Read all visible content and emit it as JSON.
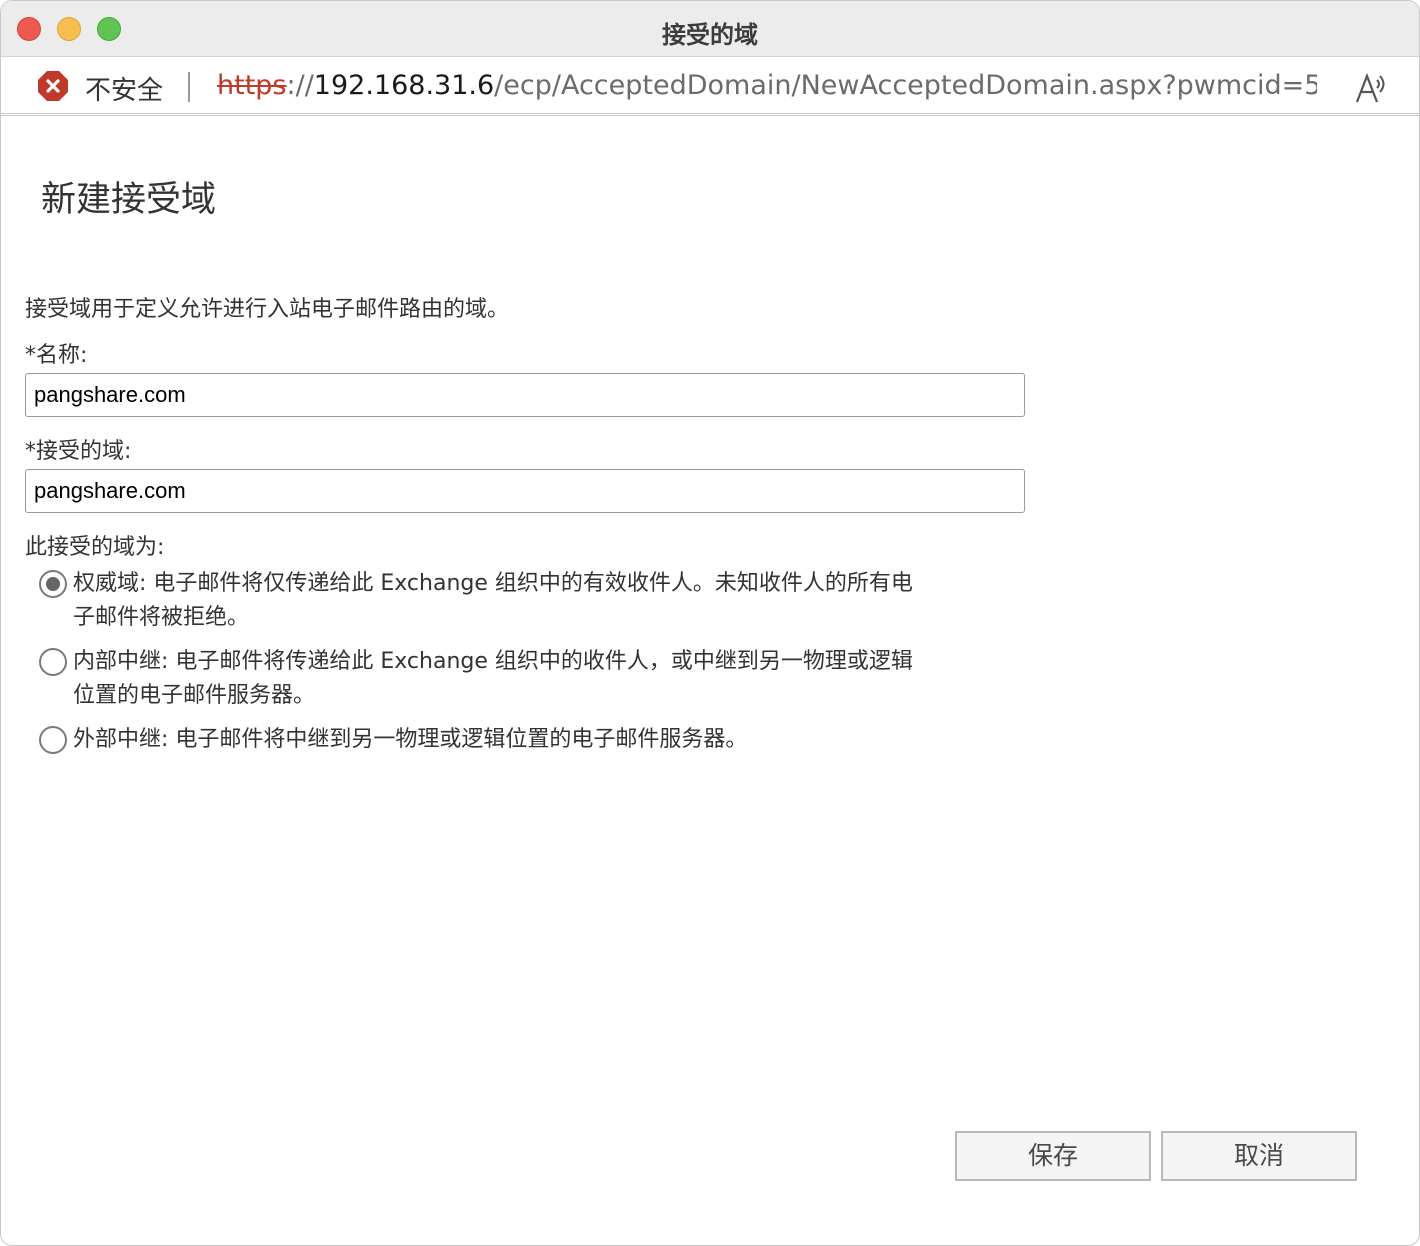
{
  "window": {
    "title": "接受的域"
  },
  "address_bar": {
    "security_label": "不安全",
    "url_scheme": "https",
    "url_sep": "://",
    "url_host": "192.168.31.6",
    "url_path": "/ecp/AcceptedDomain/NewAcceptedDomain.aspx?pwmcid=5…",
    "colors": {
      "insecure": "#c0392b"
    },
    "icons": {
      "security": "insecure-x-icon",
      "read_aloud": "read-aloud-icon"
    }
  },
  "dialog": {
    "title": "新建接受域",
    "description": "接受域用于定义允许进行入站电子邮件路由的域。",
    "name_field": {
      "label": "*名称:",
      "value": "pangshare.com"
    },
    "domain_field": {
      "label": "*接受的域:",
      "value": "pangshare.com"
    },
    "type_label": "此接受的域为:",
    "options": [
      {
        "text": "权威域: 电子邮件将仅传递给此 Exchange 组织中的有效收件人。未知收件人的所有电子邮件将被拒绝。",
        "selected": true
      },
      {
        "text": "内部中继: 电子邮件将传递给此 Exchange 组织中的收件人，或中继到另一物理或逻辑位置的电子邮件服务器。",
        "selected": false
      },
      {
        "text": "外部中继: 电子邮件将中继到另一物理或逻辑位置的电子邮件服务器。",
        "selected": false
      }
    ],
    "buttons": {
      "save": "保存",
      "cancel": "取消"
    }
  }
}
